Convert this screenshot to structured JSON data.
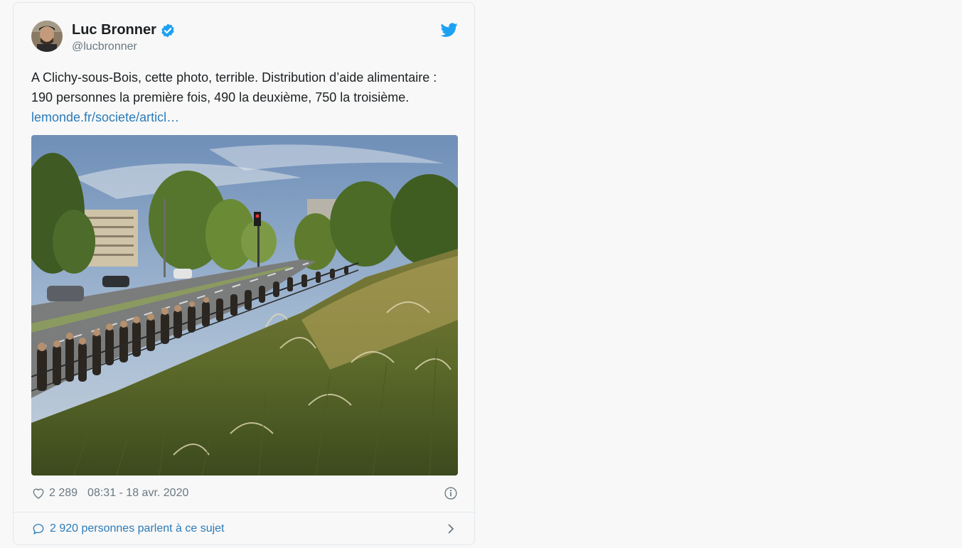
{
  "author": {
    "name": "Luc Bronner",
    "handle": "@lucbronner",
    "verified": true
  },
  "tweet": {
    "text": "A Clichy-sous-Bois, cette photo, terrible. Distribution d’aide alimentaire : 190 personnes la première fois, 490 la deuxième, 750 la troisième. ",
    "link_text": "lemonde.fr/societe/articl…"
  },
  "meta": {
    "likes": "2 289",
    "timestamp": "08:31 - 18 avr. 2020"
  },
  "conversation": {
    "label": "2 920 personnes parlent à ce sujet"
  },
  "icons": {
    "verified": "verified-badge-icon",
    "twitter": "twitter-bird-icon",
    "heart": "heart-icon",
    "info": "info-icon",
    "bubble": "speech-bubble-icon",
    "chevron": "chevron-right-icon"
  },
  "colors": {
    "accent": "#1da1f2",
    "link": "#2b7bb9",
    "muted": "#697882",
    "text": "#1c2022",
    "border": "#e1e8ed"
  }
}
